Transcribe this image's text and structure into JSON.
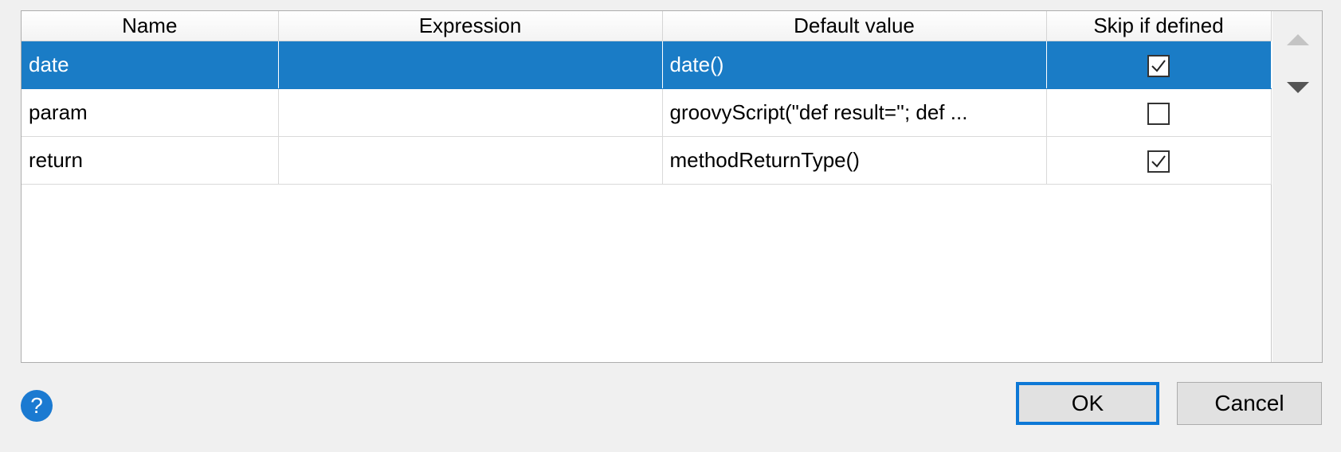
{
  "table": {
    "columns": [
      "Name",
      "Expression",
      "Default value",
      "Skip if defined"
    ],
    "rows": [
      {
        "name": "date",
        "expression": "",
        "default_value": "date()",
        "skip_if_defined": true,
        "selected": true
      },
      {
        "name": "param",
        "expression": "",
        "default_value": "groovyScript(\"def result=''; def ...",
        "skip_if_defined": false,
        "selected": false
      },
      {
        "name": "return",
        "expression": "",
        "default_value": "methodReturnType()",
        "skip_if_defined": true,
        "selected": false
      }
    ]
  },
  "side_buttons": {
    "move_up_icon": "triangle-up-icon",
    "move_down_icon": "triangle-down-icon"
  },
  "footer": {
    "help_label": "?",
    "ok_label": "OK",
    "cancel_label": "Cancel"
  },
  "colors": {
    "selection": "#1a7cc6",
    "focus_border": "#0d78d6",
    "help_icon": "#1b7ad1"
  }
}
